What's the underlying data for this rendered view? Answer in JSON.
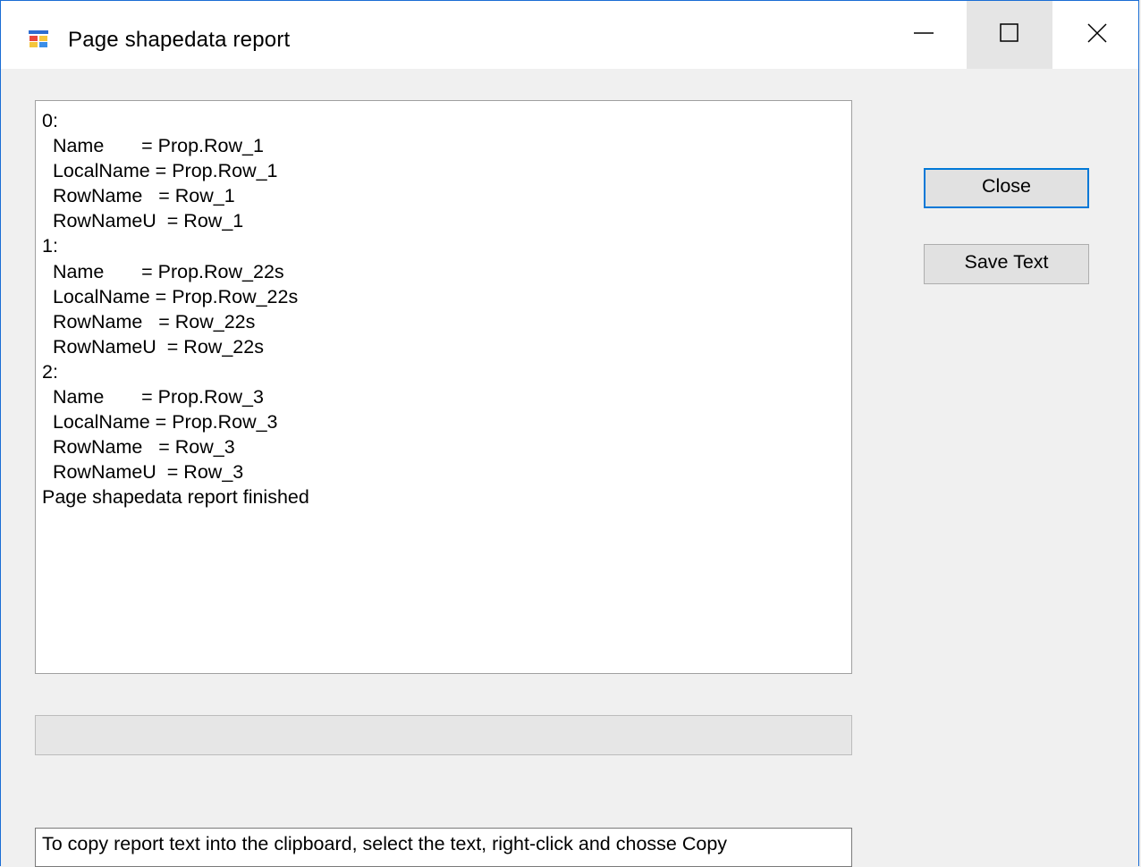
{
  "window": {
    "title": "Page shapedata report",
    "icons": {
      "app": "app-form-icon",
      "minimize": "minimize-icon",
      "maximize": "maximize-icon",
      "close": "close-icon"
    }
  },
  "report": {
    "lines": [
      "0:",
      "  Name       = Prop.Row_1",
      "  LocalName = Prop.Row_1",
      "  RowName   = Row_1",
      "  RowNameU  = Row_1",
      "1:",
      "  Name       = Prop.Row_22s",
      "  LocalName = Prop.Row_22s",
      "  RowName   = Row_22s",
      "  RowNameU  = Row_22s",
      "2:",
      "  Name       = Prop.Row_3",
      "  LocalName = Prop.Row_3",
      "  RowName   = Row_3",
      "  RowNameU  = Row_3",
      "Page shapedata report finished"
    ]
  },
  "buttons": {
    "close_label": "Close",
    "save_label": "Save Text"
  },
  "progress": {
    "value": 0
  },
  "hint": {
    "text": "To copy report text into the clipboard, select the text, right-click and chosse Copy"
  },
  "colors": {
    "accent": "#0078d7",
    "window_border": "#1a6dd4",
    "background": "#f0f0f0"
  }
}
